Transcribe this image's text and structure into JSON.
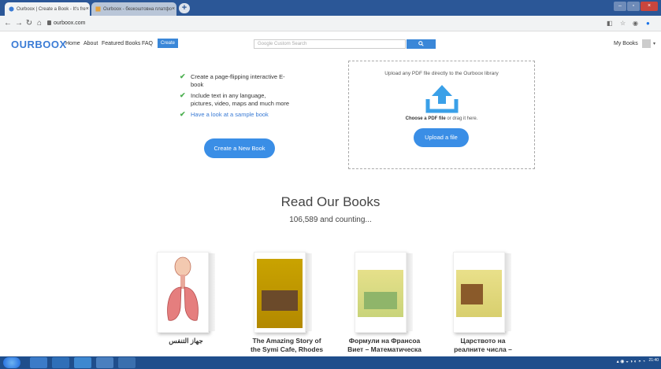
{
  "browser": {
    "tabs": [
      {
        "label": "Ourboox | Create a Book - It's fre",
        "active": true
      },
      {
        "label": "Ourboox - безкоштовна платфо",
        "active": false
      }
    ],
    "new_tab": "+",
    "url": "ourboox.com"
  },
  "site": {
    "logo": "OURBOOX",
    "nav": [
      "Home",
      "About",
      "Featured Books",
      "FAQ"
    ],
    "create": "Create",
    "search_placeholder": "Google Custom Search",
    "my_books": "My Books",
    "accent": "#3a8ee6"
  },
  "features": [
    {
      "line1": "Create a page-flipping interactive E-",
      "line2": "book"
    },
    {
      "line1": "Include text in any language,",
      "line2": "pictures, video, maps and much more"
    },
    {
      "line1": "Have a look at a sample book",
      "line2": ""
    }
  ],
  "create_book": "Create a New Book",
  "upload": {
    "title": "Upload any PDF file directly to the Ourboox library",
    "choose_bold": "Choose a PDF file",
    "choose_rest": " or drag it here.",
    "button": "Upload a file"
  },
  "library": {
    "heading": "Read Our Books",
    "count": "106,589 and counting...",
    "books": [
      {
        "title1": "جهاز التنفس",
        "title2": ""
      },
      {
        "title1": "The Amazing Story of",
        "title2": "the Symi Cafe, Rhodes"
      },
      {
        "title1": "Формули на Франсоа",
        "title2": "Виет – Математическа"
      },
      {
        "title1": "Царството на",
        "title2": "реалните числа –"
      }
    ]
  },
  "taskbar": {
    "clock_time": "21:40"
  }
}
